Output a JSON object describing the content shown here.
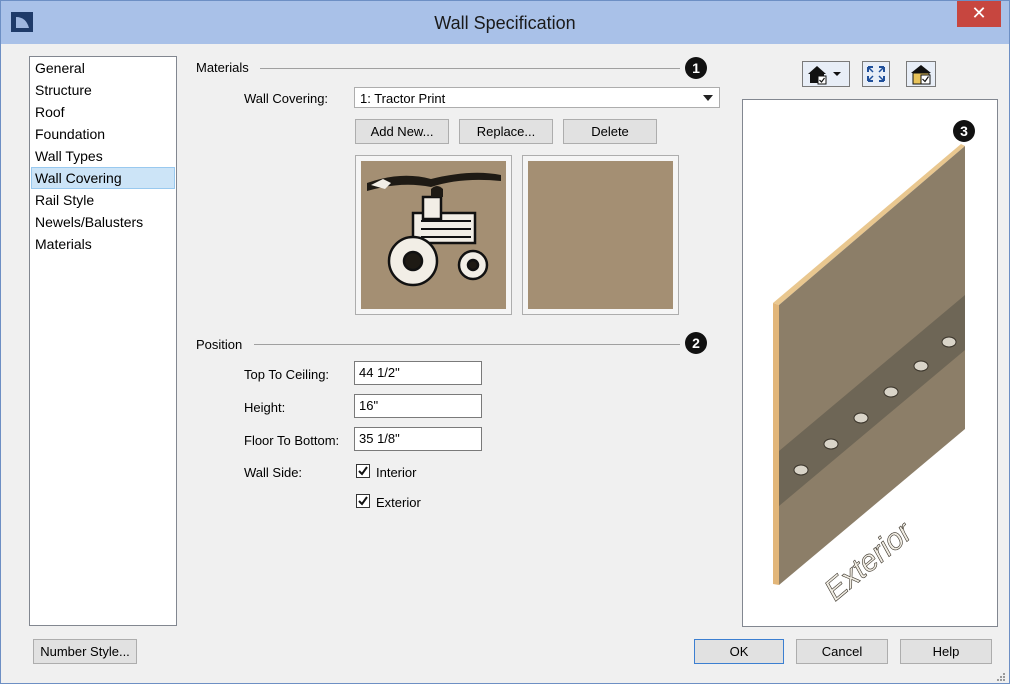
{
  "window": {
    "title": "Wall Specification",
    "close_glyph": "✕"
  },
  "sidebar": {
    "items": [
      {
        "label": "General"
      },
      {
        "label": "Structure"
      },
      {
        "label": "Roof"
      },
      {
        "label": "Foundation"
      },
      {
        "label": "Wall Types"
      },
      {
        "label": "Wall Covering",
        "selected": true
      },
      {
        "label": "Rail Style"
      },
      {
        "label": "Newels/Balusters"
      },
      {
        "label": "Materials"
      }
    ]
  },
  "materials": {
    "group_label": "Materials",
    "badge": "1",
    "wall_covering_label": "Wall Covering:",
    "wall_covering_value": "1: Tractor Print",
    "add_new_label": "Add New...",
    "replace_label": "Replace...",
    "delete_label": "Delete"
  },
  "position": {
    "group_label": "Position",
    "badge": "2",
    "top_to_ceiling_label": "Top To Ceiling:",
    "top_to_ceiling_value": "44 1/2\"",
    "height_label": "Height:",
    "height_value": "16\"",
    "floor_to_bottom_label": "Floor To Bottom:",
    "floor_to_bottom_value": "35 1/8\"",
    "wall_side_label": "Wall Side:",
    "interior_label": "Interior",
    "interior_checked": true,
    "exterior_label": "Exterior",
    "exterior_checked": true
  },
  "preview": {
    "badge": "3",
    "face_label": "Exterior"
  },
  "footer": {
    "number_style_label": "Number Style...",
    "ok_label": "OK",
    "cancel_label": "Cancel",
    "help_label": "Help"
  },
  "colors": {
    "titlebar": "#a9c1e8",
    "close": "#c7463f",
    "selection": "#cce4f7",
    "wall_face": "#8c7e68",
    "swatch_tan": "#a48f73"
  }
}
